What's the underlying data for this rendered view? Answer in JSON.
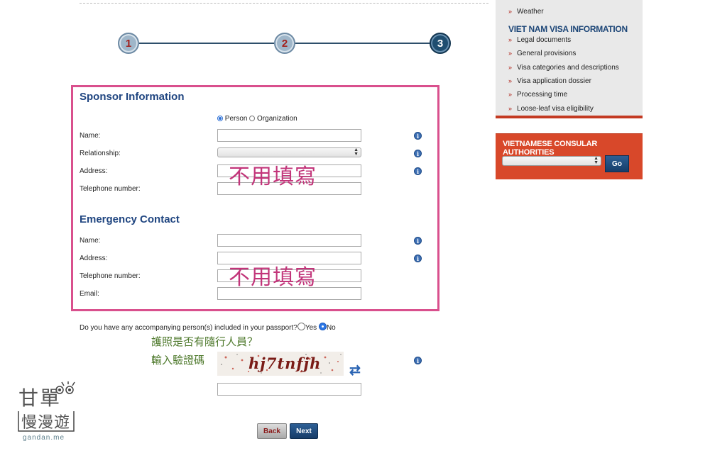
{
  "steps": [
    "1",
    "2",
    "3"
  ],
  "sponsor": {
    "title": "Sponsor Information",
    "type_person": "Person",
    "type_organization": "Organization",
    "name_label": "Name:",
    "relationship_label": "Relationship:",
    "address_label": "Address:",
    "phone_label": "Telephone number:"
  },
  "emergency": {
    "title": "Emergency Contact",
    "name_label": "Name:",
    "address_label": "Address:",
    "phone_label": "Telephone number:",
    "email_label": "Email:"
  },
  "annotations": {
    "no_fill_1": "不用填寫",
    "no_fill_2": "不用填寫",
    "passport_question": "護照是否有隨行人員？",
    "captcha_hint": "輸入驗證碼"
  },
  "accompany": {
    "question": "Do you have any accompanying person(s) included in your passport?",
    "yes": "Yes",
    "no": "No"
  },
  "captcha_text": "hj7tnfjh",
  "buttons": {
    "back": "Back",
    "next": "Next",
    "go": "Go"
  },
  "sidebar": {
    "items_top": [
      "Weather"
    ],
    "heading": "VIET NAM VISA INFORMATION",
    "items": [
      "Legal documents",
      "General provisions",
      "Visa categories and descriptions",
      "Visa application dossier",
      "Processing time",
      "Loose-leaf visa eligibility"
    ],
    "consular_title": "VIETNAMESE CONSULAR AUTHORITIES"
  },
  "logo": {
    "line1": "甘單",
    "line2": "慢漫遊",
    "site": "gandan.me"
  },
  "colors": {
    "accent_blue": "#1f4580",
    "annotation_pink": "#d9508d",
    "sidebar_red": "#d8482a",
    "annotation_green": "#4f7a2d"
  }
}
